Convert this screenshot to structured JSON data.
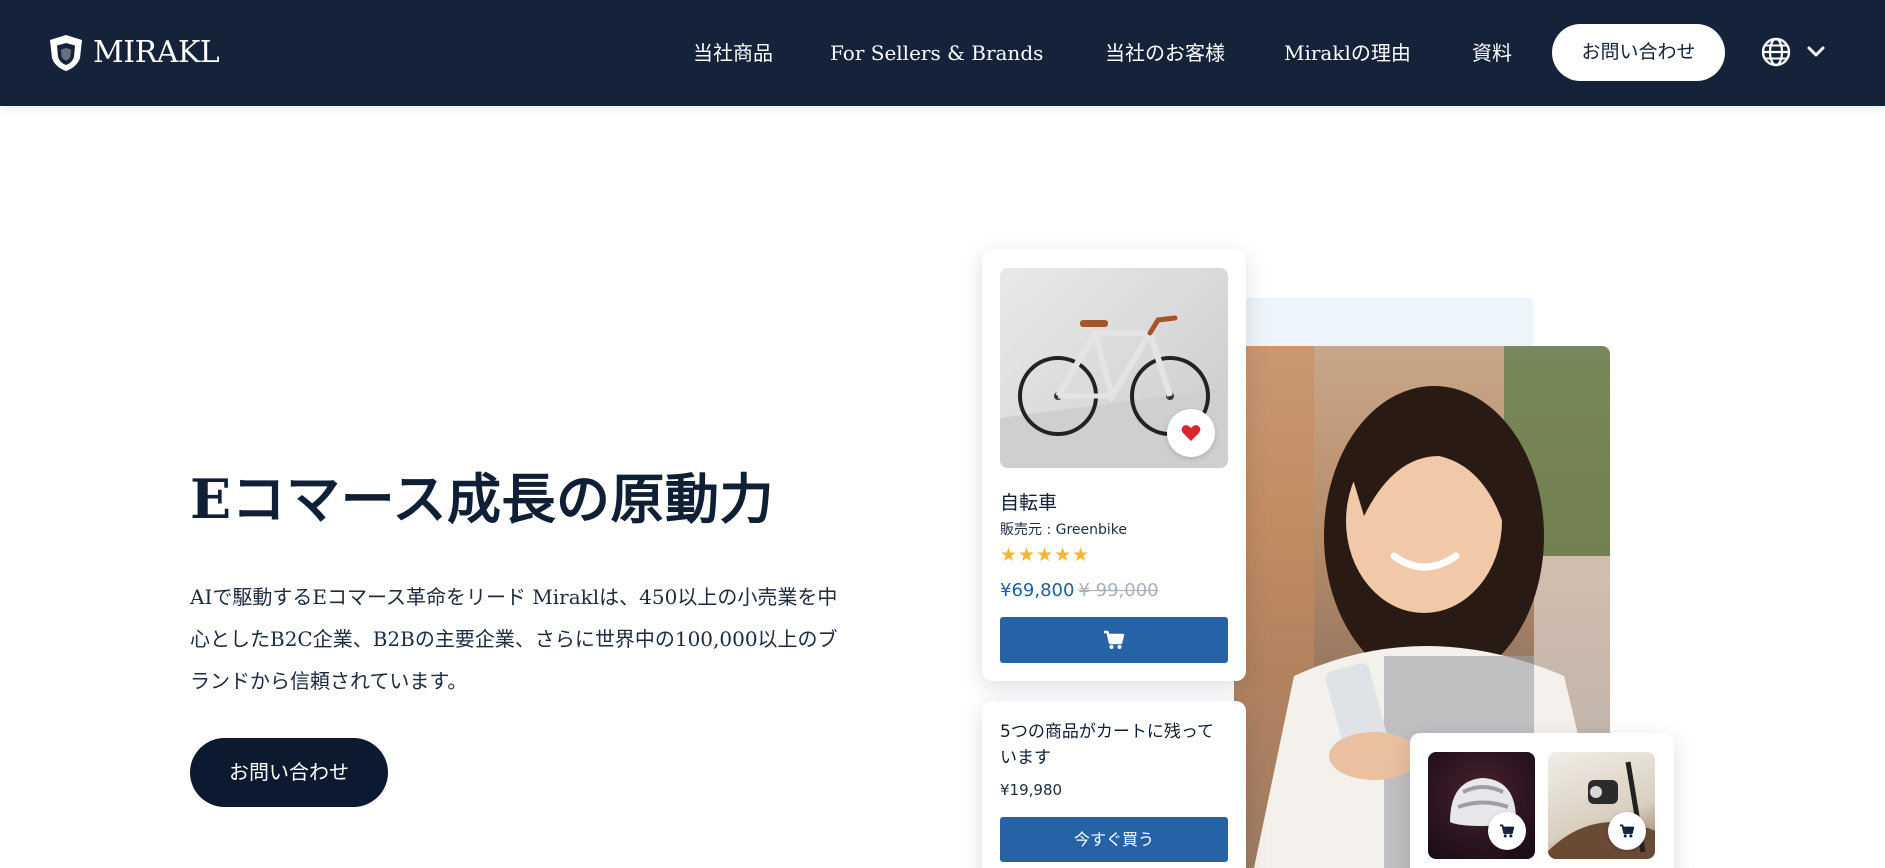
{
  "header": {
    "logo_text": "MIRAKL",
    "nav": [
      {
        "label": "当社商品"
      },
      {
        "label": "For Sellers & Brands"
      },
      {
        "label": "当社のお客様"
      },
      {
        "label": "Miraklの理由"
      },
      {
        "label": "資料"
      }
    ],
    "contact_label": "お問い合わせ",
    "language_icon": "globe-icon"
  },
  "hero": {
    "title": "Eコマース成長の原動力",
    "description": "AIで駆動するEコマース革命をリード Miraklは、450以上の小売業を中心としたB2C企業、B2Bの主要企業、さらに世界中の100,000以上のブランドから信頼されています。",
    "cta_label": "お問い合わせ"
  },
  "product_card": {
    "name": "自転車",
    "seller": "販売元 : Greenbike",
    "stars": "★★★★★",
    "rating_stars": 5,
    "price": "¥69,800",
    "old_price": "¥ 99,000"
  },
  "cart_card": {
    "message": "5つの商品がカートに残っています",
    "price": "¥19,980",
    "buy_label": "今すぐ買う"
  },
  "colors": {
    "header_bg": "#14233a",
    "primary_button": "#2563a6",
    "hero_button": "#0b1a30",
    "star": "#f5b731",
    "heart": "#d9262b"
  }
}
